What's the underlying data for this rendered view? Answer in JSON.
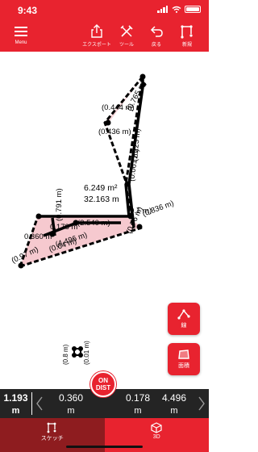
{
  "status_bar": {
    "time": "9:43"
  },
  "toolbar": {
    "menu_label": "Menu",
    "export_label": "エクスポート",
    "tools_label": "ツール",
    "undo_label": "戻る",
    "new_label": "新規"
  },
  "sketch": {
    "area": "6.249 m²",
    "perimeter": "32.163 m",
    "dimension_labels": [
      "(0.444 m)",
      "(0.765 m)",
      "(0.436 m)",
      "(2.223 m)",
      "(0.061 m)",
      "(0.791 m)",
      "(0.836 m)",
      "(0.76 m)",
      "(0.1 m)",
      "(2.540 m)",
      "0.360 m",
      "0.178 m",
      "(0.64 m)",
      "(4.496 m)",
      "(0.97 m)",
      "(0.8 m)",
      "(0.01 m)"
    ]
  },
  "fab": {
    "line_label": "線",
    "area_label": "面積"
  },
  "readout": {
    "current_value": "1.193",
    "current_unit": "m",
    "values": [
      {
        "value": "0.360",
        "unit": "m"
      },
      {
        "value": "0.178",
        "unit": "m"
      },
      {
        "value": "4.496",
        "unit": "m"
      }
    ]
  },
  "ondist": {
    "line1": "ON",
    "line2": "DIST"
  },
  "tabs": {
    "sketch_label": "スケッチ",
    "threed_label": "3D"
  },
  "colors": {
    "brand_red": "#e8232f",
    "dark_red": "#8e1c1f",
    "readout_bg": "#242424",
    "shape_fill": "#f5c6cc"
  }
}
